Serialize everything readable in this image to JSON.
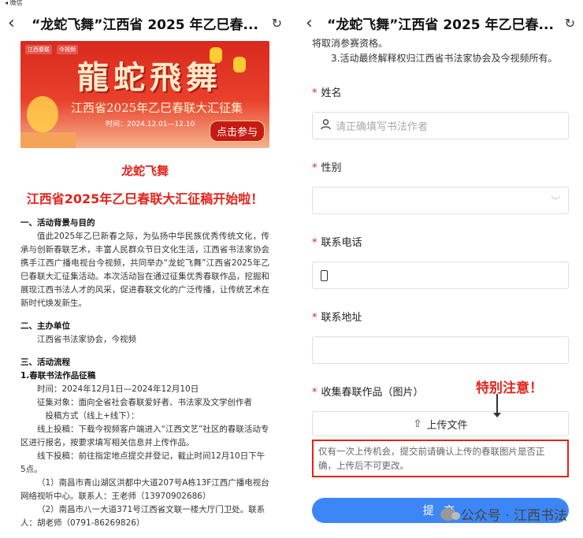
{
  "left": {
    "status": "◂ 微信",
    "nav": {
      "title": "“龙蛇飞舞”江西省 2025 年乙巳春..."
    },
    "banner": {
      "logo1": "江西春联",
      "logo2": "今视频",
      "calligraphy": "龍蛇飛舞",
      "subtitle": "江西省2025年乙巳春联大汇征集",
      "time": "时间：2024.12.01—12.10",
      "cta": "点击参与"
    },
    "heading1": "龙蛇飞舞",
    "heading2": "江西省2025年乙巳春联大汇征稿开始啦！",
    "s1_title": "一、活动背景与目的",
    "s1_body": "值此2025年乙巳新春之际，为弘扬中华民族优秀传统文化，传承与创新春联艺术，丰富人民群众节日文化生活，江西省书法家协会携手江西广播电视台今视频，共同举办“龙蛇飞舞”江西省2025年乙巳春联大汇征集活动。本次活动旨在通过征集优秀春联作品，挖掘和展现江西书法人才的风采，促进春联文化的广泛传播，让传统艺术在新时代焕发新生。",
    "s2_title": "二、主办单位",
    "s2_body": "江西省书法家协会，今视频",
    "s3_title": "三、活动流程",
    "s3_sub": "1.春联书法作品征稿",
    "time_line": "时间：2024年12月1日—2024年12月10日",
    "target_line": "征集对象：面向全省社会春联爱好者、书法家及文学创作者",
    "method_line": "投稿方式（线上+线下）：",
    "online_line": "线上投稿：下载今视频客户端进入“江西文艺”社区的春联活动专区进行报名，按要求填写相关信息并上传作品。",
    "offline_line": "线下投稿：前往指定地点提交并登记，截止时间12月10日下午5点。",
    "addr1": "（1）南昌市青山湖区洪都中大道207号A栋13F江西广播电视台网络视听中心。联系人：王老师（13970902686）",
    "addr2": "（2）南昌市八一大道371号江西省文联一楼大厅门卫处。联系人：胡老师（0791-86269826）"
  },
  "right": {
    "nav": {
      "title": "“龙蛇飞舞”江西省 2025 年乙巳春..."
    },
    "intro1": "将取消参赛资格。",
    "intro2": "3.活动最终解释权归江西省书法家协会及今视频所有。",
    "fields": {
      "name_label": "姓名",
      "name_placeholder": "请正确填写书法作者",
      "gender_label": "性别",
      "phone_label": "联系电话",
      "address_label": "联系地址",
      "works_label": "收集春联作品（图片）",
      "upload_label": "上传文件"
    },
    "annotation": "特别注意！",
    "notice": "仅有一次上传机会，提交前请确认上传的春联图片是否正确，上传后不可更改。",
    "submit": "提 交",
    "watermark": "公众号 · 江西书法",
    "required_mark": "*"
  },
  "colors": {
    "accent_red": "#e2231a",
    "submit_blue": "#3d86f5"
  }
}
